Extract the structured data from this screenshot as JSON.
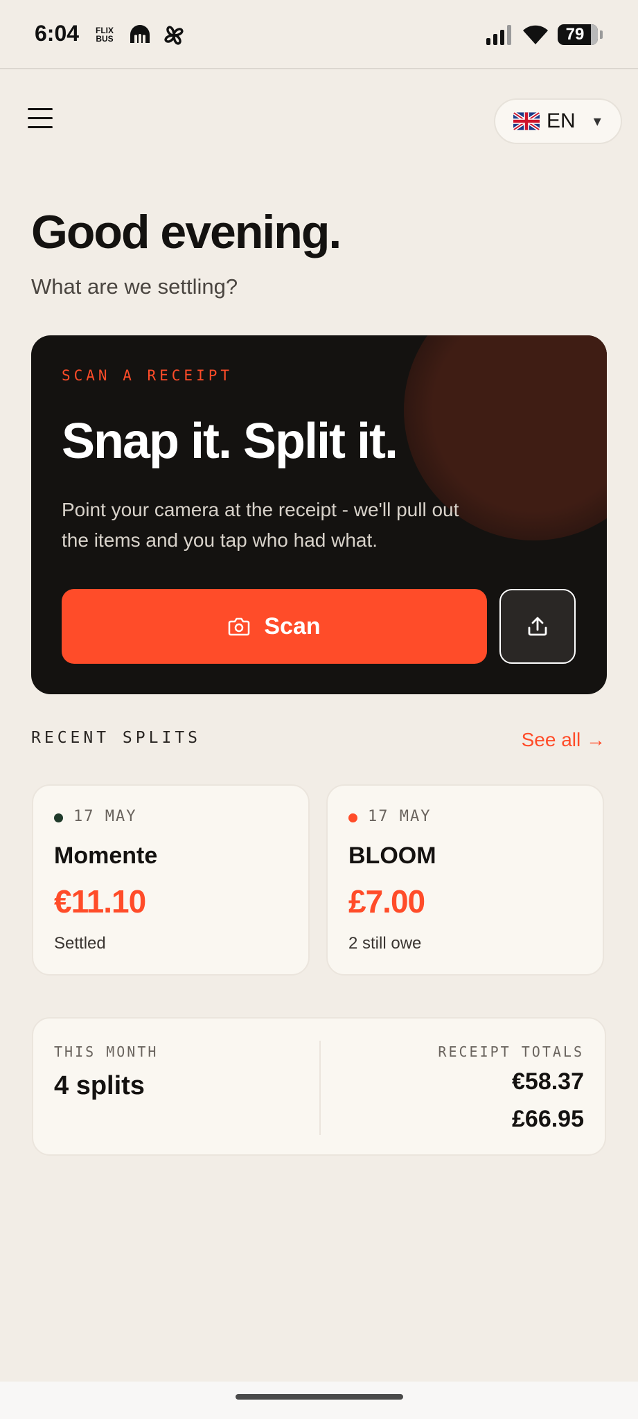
{
  "status_bar": {
    "time": "6:04",
    "flix_line1": "FLIX",
    "flix_line2": "BUS",
    "battery": "79"
  },
  "header": {
    "menu_icon": "hamburger-menu-icon",
    "language": {
      "flag_icon": "uk-flag-icon",
      "code": "EN",
      "caret": "▾"
    }
  },
  "greeting": {
    "title": "Good evening.",
    "subtitle": "What are we settling?"
  },
  "hero": {
    "eyebrow": "SCAN A RECEIPT",
    "title": "Snap it. Split it.",
    "description": "Point your camera at the receipt - we'll pull out the items and you tap who had what.",
    "scan_label": "Scan",
    "scan_icon": "camera-icon",
    "upload_icon": "upload-icon"
  },
  "recent": {
    "label": "RECENT SPLITS",
    "see_all": "See all →",
    "items": [
      {
        "date": "17 MAY",
        "name": "Momente",
        "amount": "€11.10",
        "status": "Settled",
        "dot_color": "#1f3a2a"
      },
      {
        "date": "17 MAY",
        "name": "BLOOM",
        "amount": "£7.00",
        "status": "2 still owe",
        "dot_color": "#ff4c29"
      }
    ]
  },
  "summary": {
    "month_label": "THIS MONTH",
    "month_value": "4 splits",
    "totals_label": "RECEIPT TOTALS",
    "totals": [
      "€58.37",
      "£66.95"
    ]
  },
  "colors": {
    "accent": "#ff4c29",
    "background": "#f2ede6",
    "card_dark": "#141210"
  }
}
